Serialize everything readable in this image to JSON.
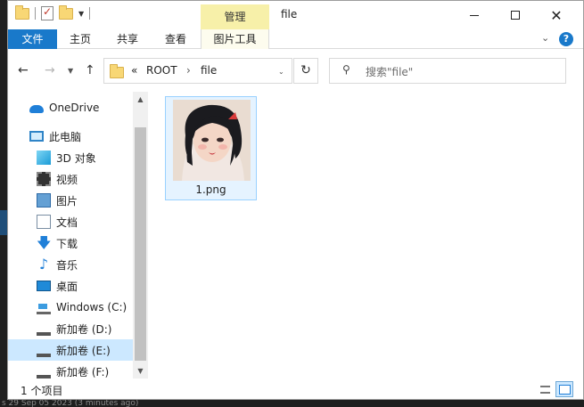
{
  "window": {
    "title": "file",
    "contextual_tab_group": "管理"
  },
  "ribbon": {
    "tabs": [
      "文件",
      "主页",
      "共享",
      "查看",
      "图片工具"
    ],
    "help": "?"
  },
  "navigation": {
    "breadcrumb_prefix": "«",
    "breadcrumb": [
      "ROOT",
      "file"
    ],
    "search_placeholder": "搜索\"file\""
  },
  "sidebar": {
    "items": [
      {
        "label": "OneDrive",
        "icon": "cloud-icon"
      },
      {
        "label": "此电脑",
        "icon": "computer-icon"
      },
      {
        "label": "3D 对象",
        "icon": "3d-objects-icon"
      },
      {
        "label": "视频",
        "icon": "video-icon"
      },
      {
        "label": "图片",
        "icon": "pictures-icon"
      },
      {
        "label": "文档",
        "icon": "documents-icon"
      },
      {
        "label": "下载",
        "icon": "download-icon"
      },
      {
        "label": "音乐",
        "icon": "music-icon"
      },
      {
        "label": "桌面",
        "icon": "desktop-icon"
      },
      {
        "label": "Windows  (C:)",
        "icon": "windows-drive-icon"
      },
      {
        "label": "新加卷 (D:)",
        "icon": "drive-icon"
      },
      {
        "label": "新加卷 (E:)",
        "icon": "drive-icon",
        "selected": true
      },
      {
        "label": "新加卷 (F:)",
        "icon": "drive-icon"
      }
    ]
  },
  "files": [
    {
      "name": "1.png",
      "type": "image",
      "selected": true
    }
  ],
  "status": {
    "item_count": "1 个项目"
  },
  "background": {
    "bottom_text": "s 29 Sep 05 2023 (3 minutes ago)"
  }
}
